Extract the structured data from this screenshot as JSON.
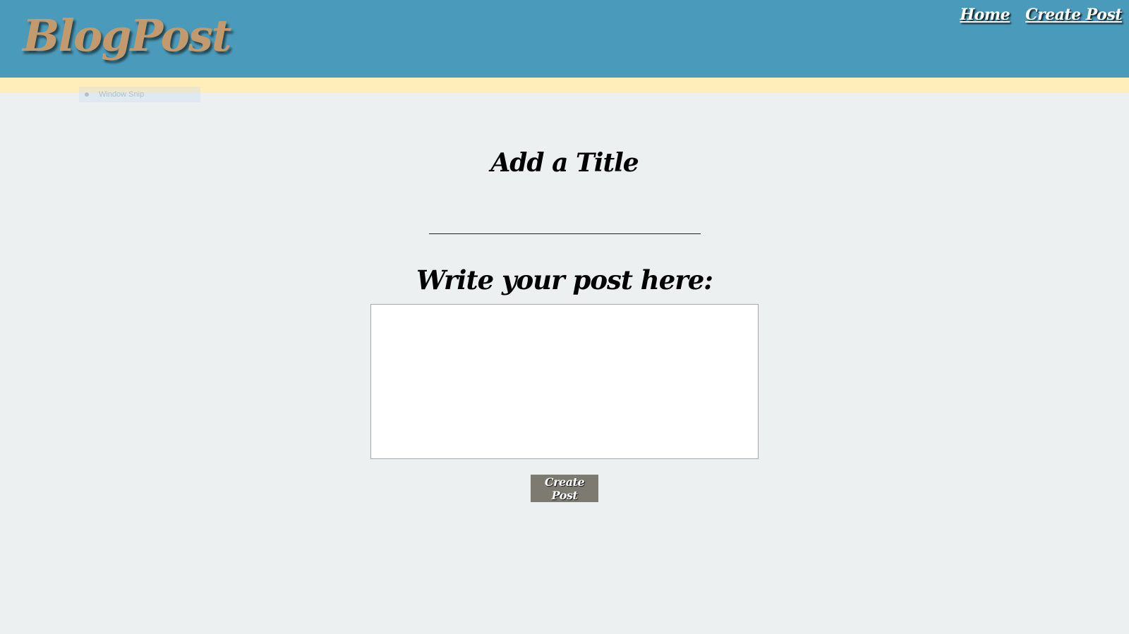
{
  "app": {
    "logo_text": "BlogPost"
  },
  "nav": {
    "items": [
      {
        "label": "Home"
      },
      {
        "label": "Create Post"
      }
    ]
  },
  "overlay": {
    "window_snip_label": "Window Snip"
  },
  "form": {
    "title_heading": "Add a Title",
    "title_value": "",
    "post_heading": "Write your post here:",
    "post_value": "",
    "submit_label": "Create Post"
  },
  "colors": {
    "header_bg": "#4a9bbb",
    "logo": "#c49a6c",
    "band": "#ffedba",
    "page_bg": "#ecf0f1",
    "button_bg": "#7d7a72"
  }
}
